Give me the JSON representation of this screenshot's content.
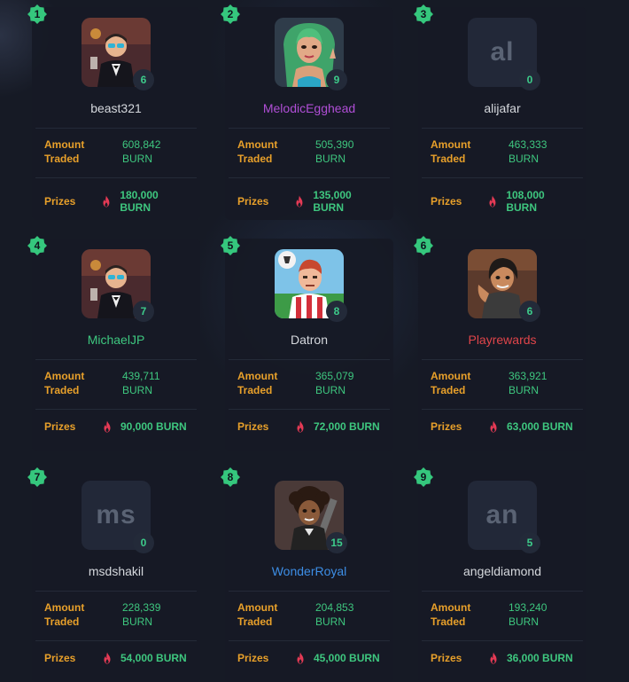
{
  "labels": {
    "amount": "Amount",
    "traded": "Traded",
    "prizes": "Prizes"
  },
  "colors": {
    "background": "#161a25",
    "card": "#161a25",
    "accent_green": "#3ec77f",
    "label_orange": "#e8a02a",
    "flame_red": "#e63a55"
  },
  "players": [
    {
      "rank": "1",
      "name": "beast321",
      "level": "6",
      "amount": "608,842",
      "unit": "BURN",
      "prize": "180,000 BURN",
      "avatar": "tuxedo-man",
      "name_color": "white"
    },
    {
      "rank": "2",
      "name": "MelodicEgghead",
      "level": "9",
      "amount": "505,390",
      "unit": "BURN",
      "prize": "135,000 BURN",
      "avatar": "green-hair-woman",
      "name_color": "purple"
    },
    {
      "rank": "3",
      "name": "alijafar",
      "level": "0",
      "amount": "463,333",
      "unit": "BURN",
      "prize": "108,000 BURN",
      "avatar_text": "al",
      "name_color": "white"
    },
    {
      "rank": "4",
      "name": "MichaelJP",
      "level": "7",
      "amount": "439,711",
      "unit": "BURN",
      "prize": "90,000 BURN",
      "avatar": "tuxedo-man",
      "name_color": "green"
    },
    {
      "rank": "5",
      "name": "Datron",
      "level": "8",
      "amount": "365,079",
      "unit": "BURN",
      "prize": "72,000 BURN",
      "avatar": "soccer-player",
      "name_color": "white"
    },
    {
      "rank": "6",
      "name": "Playrewards",
      "level": "6",
      "amount": "363,921",
      "unit": "BURN",
      "prize": "63,000 BURN",
      "avatar": "pirate-woman",
      "name_color": "red"
    },
    {
      "rank": "7",
      "name": "msdshakil",
      "level": "0",
      "amount": "228,339",
      "unit": "BURN",
      "prize": "54,000 BURN",
      "avatar_text": "ms",
      "name_color": "white"
    },
    {
      "rank": "8",
      "name": "WonderRoyal",
      "level": "15",
      "amount": "204,853",
      "unit": "BURN",
      "prize": "45,000 BURN",
      "avatar": "curly-woman",
      "name_color": "blue"
    },
    {
      "rank": "9",
      "name": "angeldiamond",
      "level": "5",
      "amount": "193,240",
      "unit": "BURN",
      "prize": "36,000 BURN",
      "avatar_text": "an",
      "name_color": "white"
    }
  ]
}
